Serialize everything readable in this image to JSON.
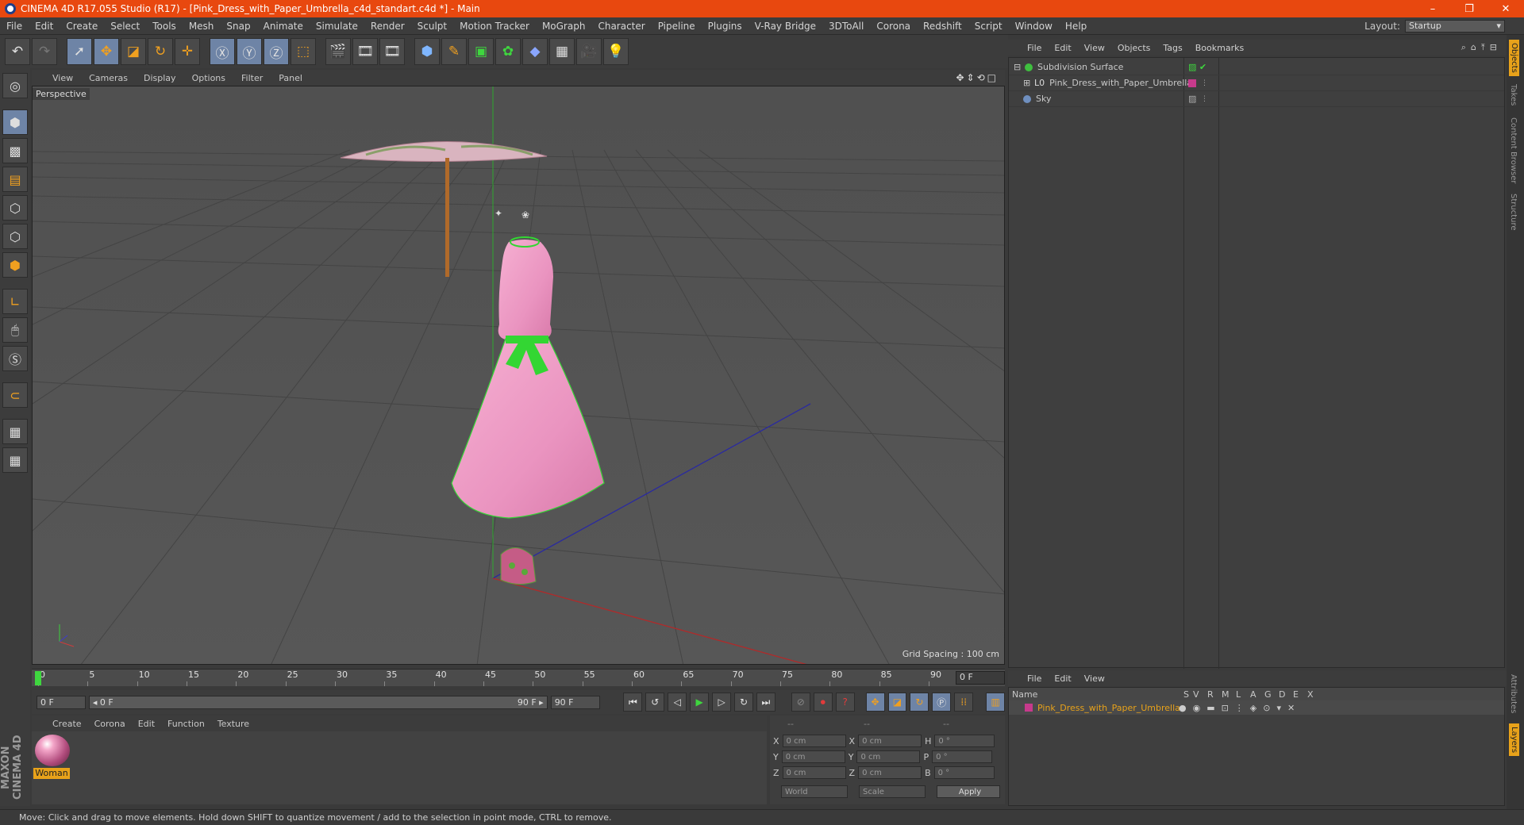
{
  "window": {
    "title": "CINEMA 4D R17.055 Studio (R17) - [Pink_Dress_with_Paper_Umbrella_c4d_standart.c4d *] - Main",
    "minimize": "–",
    "restore": "❐",
    "close": "✕"
  },
  "menu": [
    "File",
    "Edit",
    "Create",
    "Select",
    "Tools",
    "Mesh",
    "Snap",
    "Animate",
    "Simulate",
    "Render",
    "Sculpt",
    "Motion Tracker",
    "MoGraph",
    "Character",
    "Pipeline",
    "Plugins",
    "V-Ray Bridge",
    "3DToAll",
    "Corona",
    "Redshift",
    "Script",
    "Window",
    "Help"
  ],
  "layout": {
    "label": "Layout:",
    "value": "Startup"
  },
  "viewport": {
    "menu": [
      "View",
      "Cameras",
      "Display",
      "Options",
      "Filter",
      "Panel"
    ],
    "label": "Perspective",
    "grid_spacing": "Grid Spacing : 100 cm",
    "nav_icons": "✥⇕⟲□"
  },
  "timeline": {
    "ticks": [
      "0",
      "5",
      "10",
      "15",
      "20",
      "25",
      "30",
      "35",
      "40",
      "45",
      "50",
      "55",
      "60",
      "65",
      "70",
      "75",
      "80",
      "85",
      "90"
    ],
    "current": "0 F",
    "start_field": "0 F",
    "range_left": "◂ 0 F",
    "range_right": "90 F ▸",
    "end_field": "90 F"
  },
  "material": {
    "menu": [
      "Create",
      "Corona",
      "Edit",
      "Function",
      "Texture"
    ],
    "name": "Woman"
  },
  "coords": {
    "headers": [
      "--",
      "--",
      "--"
    ],
    "rows": [
      {
        "a": "X",
        "av": "0 cm",
        "b": "X",
        "bv": "0 cm",
        "c": "H",
        "cv": "0 °"
      },
      {
        "a": "Y",
        "av": "0 cm",
        "b": "Y",
        "bv": "0 cm",
        "c": "P",
        "cv": "0 °"
      },
      {
        "a": "Z",
        "av": "0 cm",
        "b": "Z",
        "bv": "0 cm",
        "c": "B",
        "cv": "0 °"
      }
    ],
    "world": "World",
    "scale": "Scale",
    "apply": "Apply"
  },
  "objects": {
    "menu": [
      "File",
      "Edit",
      "View",
      "Objects",
      "Tags",
      "Bookmarks"
    ],
    "items": [
      {
        "name": "Subdivision Surface",
        "color": "#3fbf3f"
      },
      {
        "name": "Pink_Dress_with_Paper_Umbrella",
        "color": "#c73a8c"
      },
      {
        "name": "Sky",
        "color": "#6f8fbf"
      }
    ]
  },
  "layers": {
    "menu": [
      "File",
      "Edit",
      "View"
    ],
    "columns": [
      "Name",
      "S",
      "V",
      "R",
      "M",
      "L",
      "A",
      "G",
      "D",
      "E",
      "X"
    ],
    "row": "Pink_Dress_with_Paper_Umbrella"
  },
  "right_tabs": [
    "Objects",
    "Takes",
    "Content Browser",
    "Structure",
    "Attributes",
    "Layers"
  ],
  "status": "Move: Click and drag to move elements. Hold down SHIFT to quantize movement / add to the selection in point mode, CTRL to remove.",
  "brand": "MAXON CINEMA 4D",
  "colors": {
    "title_bar": "#e8480f",
    "accent": "#e8a21a",
    "dress": "#f0a0c8",
    "bow": "#33d633"
  }
}
